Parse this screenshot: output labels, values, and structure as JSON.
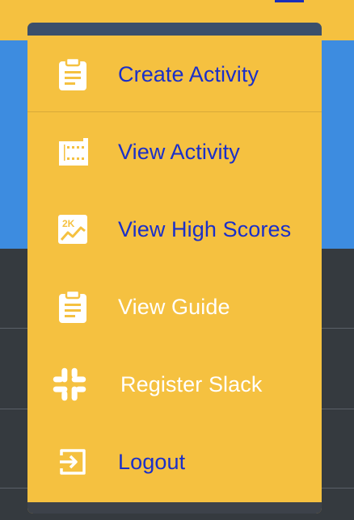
{
  "menu": {
    "items": [
      {
        "label": "Create Activity",
        "icon": "clipboard-icon",
        "color": "#1a2fc9"
      },
      {
        "label": "View Activity",
        "icon": "film-icon",
        "color": "#1a2fc9"
      },
      {
        "label": "View High Scores",
        "icon": "chart-2k-icon",
        "color": "#1a2fc9"
      },
      {
        "label": "View Guide",
        "icon": "clipboard-icon",
        "color": "#ffffff"
      },
      {
        "label": "Register Slack",
        "icon": "slack-icon",
        "color": "#ffffff"
      },
      {
        "label": "Logout",
        "icon": "logout-icon",
        "color": "#1a2fc9"
      }
    ]
  },
  "colors": {
    "menu_bg": "#f5c140",
    "page_blue": "#3d8ce0",
    "page_dark": "#353a3f",
    "link_blue": "#1a2fc9"
  }
}
